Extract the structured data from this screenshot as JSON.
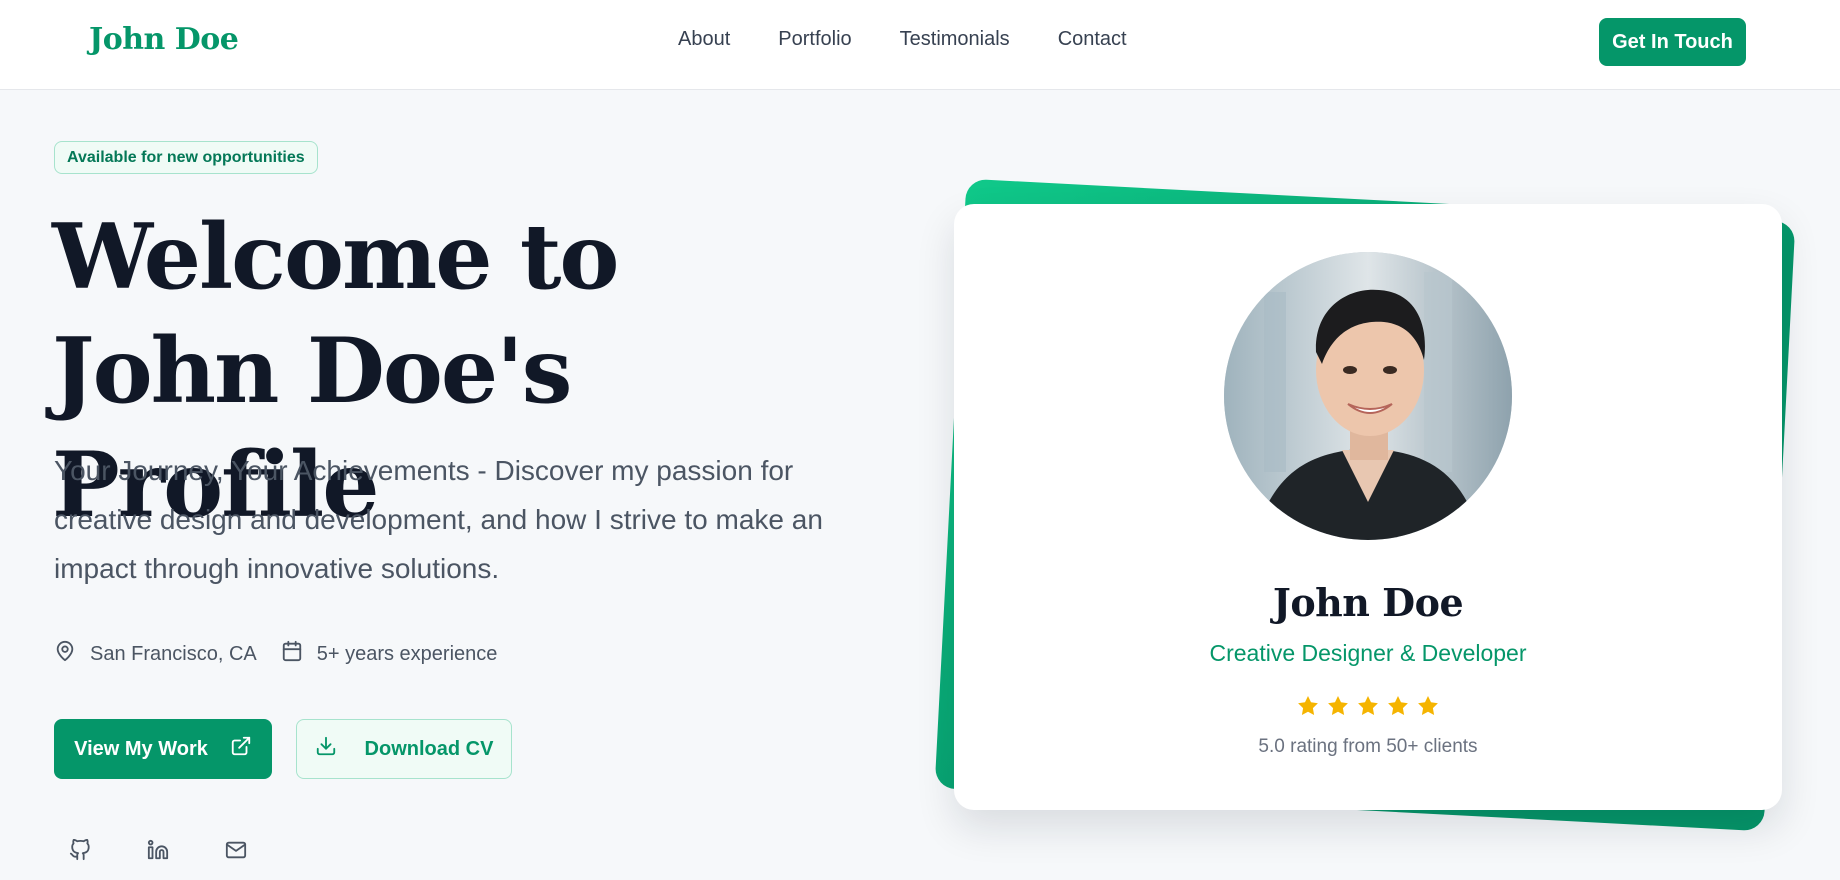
{
  "header": {
    "logo": "John Doe",
    "nav": [
      "About",
      "Portfolio",
      "Testimonials",
      "Contact"
    ],
    "cta": "Get In Touch"
  },
  "hero": {
    "badge": "Available for new opportunities",
    "title": "Welcome to John Doe's Profile",
    "description": "Your Journey, Your Achievements - Discover my passion for creative design and development, and how I strive to make an impact through innovative solutions.",
    "location": "San Francisco, CA",
    "experience": "5+ years experience",
    "primary_button": "View My Work",
    "secondary_button": "Download CV",
    "social_icons": [
      "github-icon",
      "linkedin-icon",
      "mail-icon"
    ]
  },
  "profile_card": {
    "name": "John Doe",
    "role": "Creative Designer & Developer",
    "rating_stars": 5,
    "rating_text": "5.0 rating from 50+ clients"
  },
  "colors": {
    "brand": "#059669",
    "star": "#f5b400",
    "heading": "#111827",
    "body_text": "#4b5563"
  }
}
